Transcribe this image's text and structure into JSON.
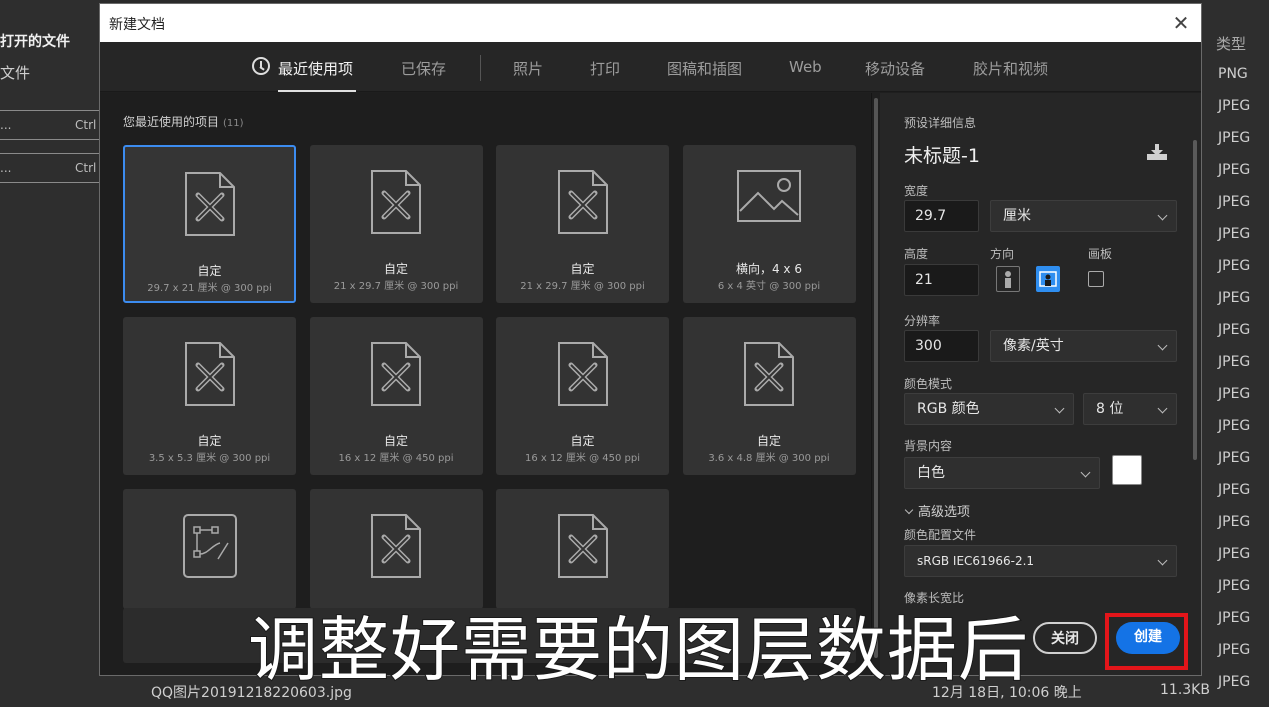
{
  "background_app": {
    "left_items": [
      "打开的文件",
      "文件"
    ],
    "rows": [
      {
        "a": "...",
        "b": "Ctrl"
      },
      {
        "a": "...",
        "b": "Ctrl"
      }
    ],
    "type_header": "类型",
    "file_types": [
      "PNG",
      "JPEG",
      "JPEG",
      "JPEG",
      "JPEG",
      "JPEG",
      "JPEG",
      "JPEG",
      "JPEG",
      "JPEG",
      "JPEG",
      "JPEG",
      "JPEG",
      "JPEG",
      "JPEG",
      "JPEG",
      "JPEG",
      "JPEG",
      "JPEG",
      "JPEG"
    ],
    "bottom_file": {
      "name": "QQ图片20191218220603.jpg",
      "date": "12月 18日, 10:06 晚上",
      "size": "11.3KB"
    }
  },
  "dialog": {
    "title": "新建文档",
    "close_glyph": "✕",
    "tabs": [
      "最近使用项",
      "已保存",
      "照片",
      "打印",
      "图稿和插图",
      "Web",
      "移动设备",
      "胶片和视频"
    ],
    "active_tab": 0,
    "section_title": "您最近使用的项目",
    "section_count": "(11)",
    "presets": [
      {
        "name": "自定",
        "meta": "29.7 x 21 厘米 @ 300 ppi",
        "icon": "document-pencil-icon"
      },
      {
        "name": "自定",
        "meta": "21 x 29.7 厘米 @ 300 ppi",
        "icon": "document-pencil-icon"
      },
      {
        "name": "自定",
        "meta": "21 x 29.7 厘米 @ 300 ppi",
        "icon": "document-pencil-icon"
      },
      {
        "name": "横向，4 x 6",
        "meta": "6 x 4 英寸 @ 300 ppi",
        "icon": "image-icon"
      },
      {
        "name": "自定",
        "meta": "3.5 x 5.3 厘米 @ 300 ppi",
        "icon": "document-pencil-icon"
      },
      {
        "name": "自定",
        "meta": "16 x 12 厘米 @ 450 ppi",
        "icon": "document-pencil-icon"
      },
      {
        "name": "自定",
        "meta": "16 x 12 厘米 @ 450 ppi",
        "icon": "document-pencil-icon"
      },
      {
        "name": "自定",
        "meta": "3.6 x 4.8 厘米 @ 300 ppi",
        "icon": "document-pencil-icon"
      },
      {
        "name": "",
        "meta": "",
        "icon": "vector-artboard-icon"
      },
      {
        "name": "",
        "meta": "",
        "icon": "document-pencil-icon"
      },
      {
        "name": "",
        "meta": "",
        "icon": "document-pencil-icon"
      }
    ],
    "details": {
      "header": "预设详细信息",
      "doc_name": "未标题-1",
      "width_label": "宽度",
      "width_value": "29.7",
      "width_unit": "厘米",
      "height_label": "高度",
      "height_value": "21",
      "orientation_label": "方向",
      "artboard_label": "画板",
      "resolution_label": "分辨率",
      "resolution_value": "300",
      "resolution_unit": "像素/英寸",
      "color_mode_label": "颜色模式",
      "color_mode_value": "RGB 颜色",
      "bit_depth": "8 位",
      "background_label": "背景内容",
      "background_value": "白色",
      "advanced_label": "高级选项",
      "color_profile_label": "颜色配置文件",
      "color_profile_value": "sRGB IEC61966-2.1",
      "pixel_aspect_label": "像素长宽比"
    },
    "buttons": {
      "close": "关闭",
      "create": "创建"
    }
  },
  "overlay": {
    "subtitle": "调整好需要的图层数据后"
  },
  "colors": {
    "accent": "#1473e6",
    "highlight": "#e3151a",
    "selected_border": "#3c8cf0"
  }
}
